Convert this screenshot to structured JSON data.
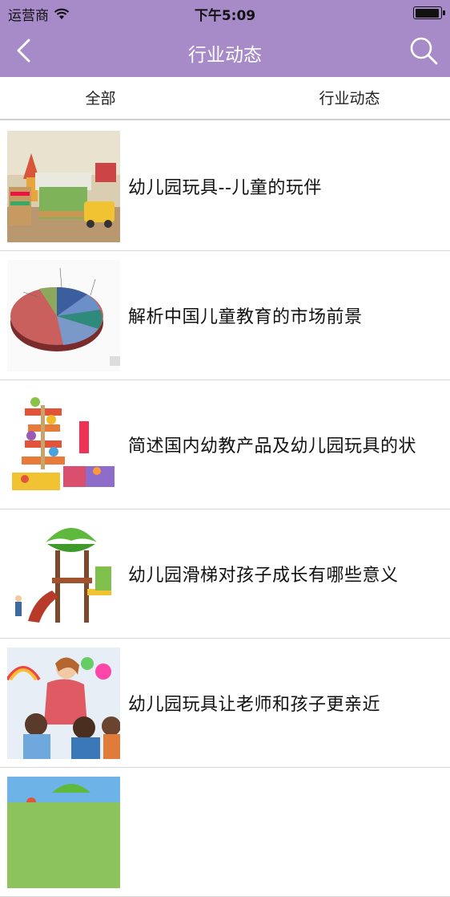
{
  "status_bar": {
    "carrier": "运营商",
    "time": "下午5:09"
  },
  "nav": {
    "title": "行业动态"
  },
  "tabs": [
    {
      "label": "全部"
    },
    {
      "label": "行业动态"
    }
  ],
  "articles": [
    {
      "title": "幼儿园玩具--儿童的玩伴",
      "thumb": "classroom-toys"
    },
    {
      "title": "解析中国儿童教育的市场前景",
      "thumb": "pie-chart"
    },
    {
      "title": "简述国内幼教产品及幼儿园玩具的状",
      "thumb": "stacking-toy"
    },
    {
      "title": "幼儿园滑梯对孩子成长有哪些意义",
      "thumb": "playground-slide"
    },
    {
      "title": "幼儿园玩具让老师和孩子更亲近",
      "thumb": "teacher-children"
    },
    {
      "title": "",
      "thumb": "playground-outdoor"
    }
  ],
  "colors": {
    "nav_bg": "#a78ac8",
    "divider": "#d6d6d6"
  }
}
